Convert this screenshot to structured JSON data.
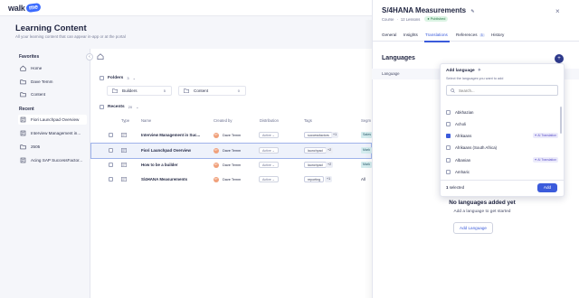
{
  "logo": {
    "word": "walk",
    "badge": "me"
  },
  "page": {
    "title": "Learning Content",
    "subtitle": "All your learning content that can appear in-app or at the portal"
  },
  "sidebar": {
    "favorites_heading": "Favorites",
    "favorites": [
      {
        "label": "Home"
      },
      {
        "label": "Dave Temm"
      },
      {
        "label": "Content"
      }
    ],
    "recent_heading": "Recent",
    "recent": [
      {
        "label": "Fiori Launchpad Overview"
      },
      {
        "label": "Interview Management in..."
      },
      {
        "label": "2505"
      },
      {
        "label": "Acing SAP SuccessFactor..."
      }
    ]
  },
  "folders": {
    "label": "Folders",
    "count": "3",
    "items": [
      {
        "label": "Builders",
        "count": "5"
      },
      {
        "label": "Content",
        "count": "0"
      }
    ]
  },
  "recents": {
    "label": "Recents",
    "count": "20"
  },
  "table": {
    "headers": {
      "type": "Type",
      "name": "Name",
      "created_by": "Created by",
      "distribution": "Distribution",
      "tags": "Tags",
      "segments": "Segm"
    },
    "rows": [
      {
        "name": "Interview Management in Suc...",
        "creator": "Dave Temm",
        "initials": "DT",
        "distribution": "Active",
        "tag": "successfactors",
        "more": "+1",
        "segment": "Sales",
        "selected": false
      },
      {
        "name": "Fiori Launchpad Overview",
        "creator": "Dave Temm",
        "initials": "DT",
        "distribution": "Active",
        "tag": "launchpad",
        "more": "+2",
        "segment": "Mark",
        "selected": true
      },
      {
        "name": "How to be a builder",
        "creator": "Dave Temm",
        "initials": "DT",
        "distribution": "Active",
        "tag": "launchpad",
        "more": "+2",
        "segment": "Mark",
        "selected": false
      },
      {
        "name": "S/4HANA Measurements",
        "creator": "Dave Temm",
        "initials": "DT",
        "distribution": "Active",
        "tag": "reporting",
        "more": "+1",
        "segment": "All",
        "selected": false
      }
    ]
  },
  "panel": {
    "title": "S/4HANA Measurements",
    "kind": "Course",
    "lessons": "12 Lessons",
    "status": "Published",
    "tabs": [
      {
        "label": "General"
      },
      {
        "label": "Insights"
      },
      {
        "label": "Translations"
      },
      {
        "label": "References",
        "badge": "3"
      },
      {
        "label": "History"
      }
    ],
    "languages_title": "Languages",
    "language_column": "Language",
    "empty_title": "No languages added yet",
    "empty_sub": "Add a language to get started",
    "add_language": "Add Language"
  },
  "dropdown": {
    "title": "Add language",
    "subtitle": "Select the languages you want to add",
    "search_placeholder": "Search...",
    "languages": [
      {
        "label": "Abkhazian",
        "checked": false,
        "ai": ""
      },
      {
        "label": "Acholi",
        "checked": false,
        "ai": ""
      },
      {
        "label": "Afrikaans",
        "checked": true,
        "ai": "AI Translation"
      },
      {
        "label": "Afrikaans (South Africa)",
        "checked": false,
        "ai": ""
      },
      {
        "label": "Albanian",
        "checked": false,
        "ai": "AI Translation"
      },
      {
        "label": "Amharic",
        "checked": false,
        "ai": ""
      }
    ],
    "selected_count": "1",
    "selected_label": "selected",
    "add_button": "Add"
  },
  "colors": {
    "accent": "#3b5bdb",
    "navy": "#2e3a8c",
    "published_bg": "#dcf4e4"
  }
}
